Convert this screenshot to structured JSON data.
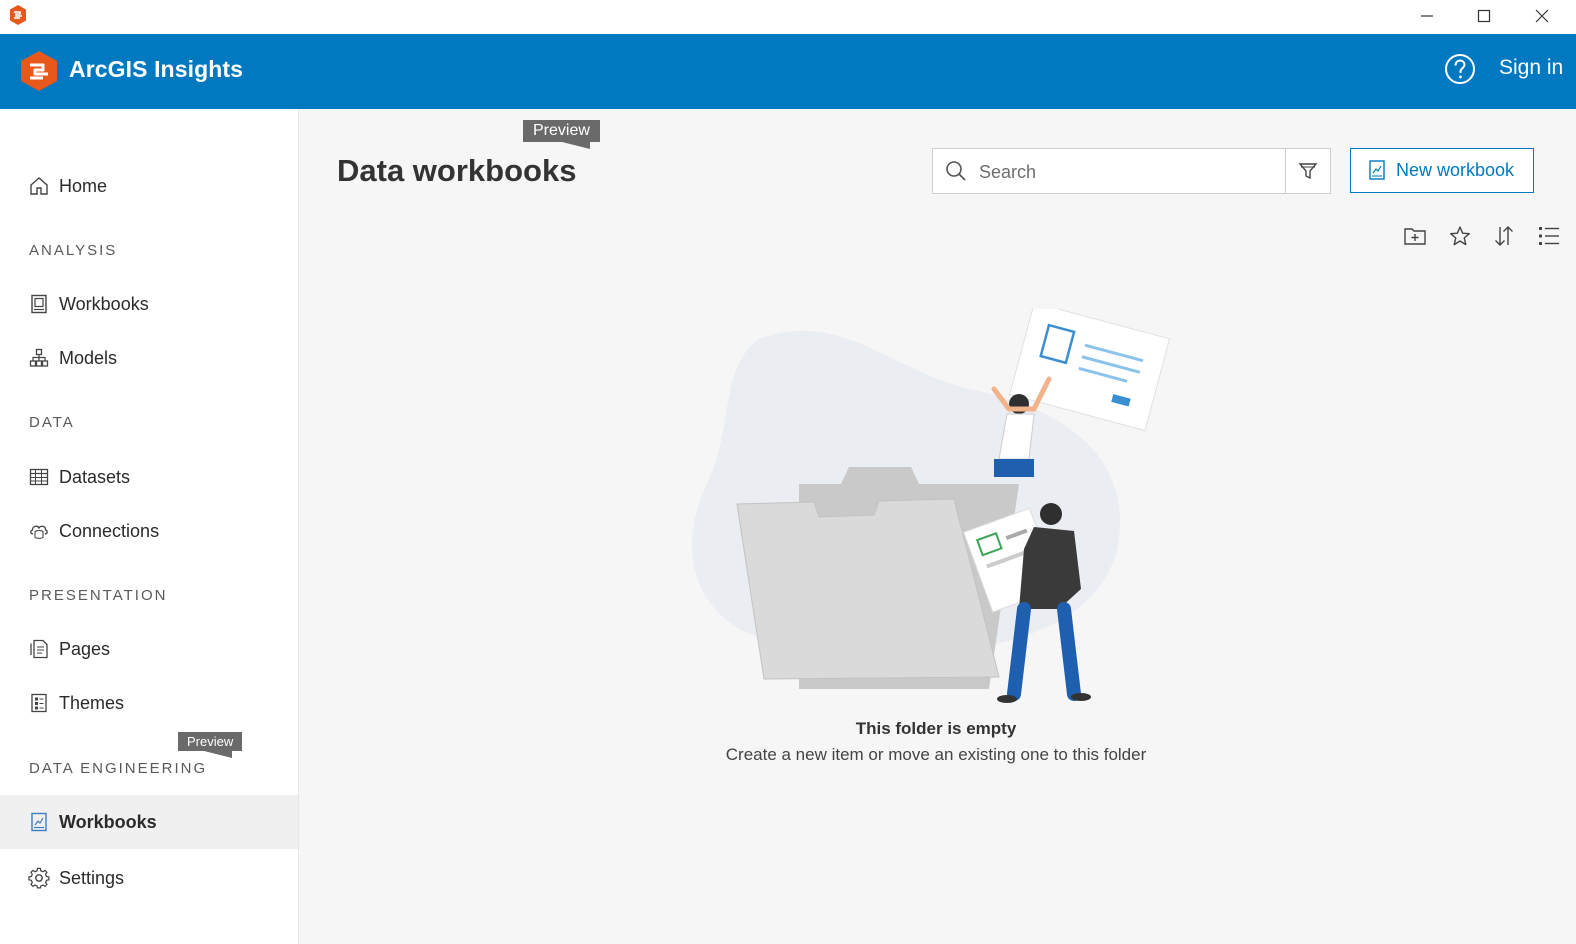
{
  "window": {
    "controls": {
      "minimize": "minimize-icon",
      "maximize": "maximize-icon",
      "close": "close-icon"
    }
  },
  "header": {
    "brand": "ArcGIS Insights",
    "sign_in": "Sign in",
    "help_icon": "help-icon",
    "colors": {
      "header_bg": "#0079c1",
      "logo": "#e8581a"
    }
  },
  "sidebar": {
    "home": {
      "label": "Home",
      "icon": "home-icon"
    },
    "sections": {
      "analysis": "ANALYSIS",
      "data": "DATA",
      "presentation": "PRESENTATION",
      "data_engineering": "DATA ENGINEERING"
    },
    "items": {
      "workbooks": {
        "label": "Workbooks",
        "icon": "workbook-icon"
      },
      "models": {
        "label": "Models",
        "icon": "model-icon"
      },
      "datasets": {
        "label": "Datasets",
        "icon": "table-icon"
      },
      "connections": {
        "label": "Connections",
        "icon": "cloud-database-icon"
      },
      "pages": {
        "label": "Pages",
        "icon": "pages-icon"
      },
      "themes": {
        "label": "Themes",
        "icon": "themes-icon"
      },
      "de_workbooks": {
        "label": "Workbooks",
        "icon": "data-workbook-icon",
        "active": true
      },
      "settings": {
        "label": "Settings",
        "icon": "gear-icon"
      }
    },
    "preview_badge": "Preview"
  },
  "main": {
    "title": "Data workbooks",
    "preview_badge": "Preview",
    "search": {
      "placeholder": "Search",
      "value": ""
    },
    "filter_icon": "filter-icon",
    "new_button": "New workbook",
    "toolbar": [
      "new-folder-icon",
      "star-icon",
      "sort-icon",
      "list-view-icon"
    ],
    "empty_state": {
      "title": "This folder is empty",
      "message": "Create a new item or move an existing one to this folder"
    },
    "colors": {
      "accent": "#0079c1"
    }
  }
}
